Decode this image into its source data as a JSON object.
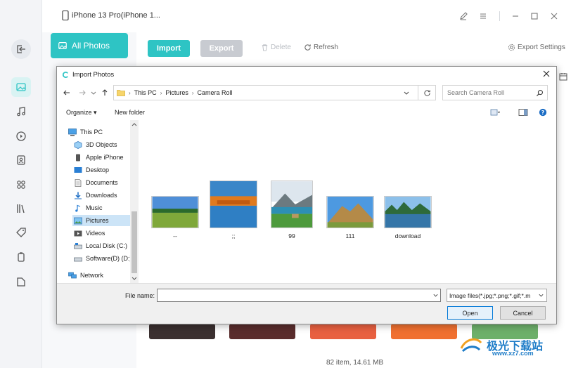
{
  "app": {
    "device_name": "iPhone 13 Pro(iPhone 1...",
    "nav_button": "All Photos",
    "toolbar": {
      "import_label": "Import",
      "export_label": "Export",
      "delete_label": "Delete",
      "refresh_label": "Refresh",
      "settings_label": "Export Settings"
    },
    "status": "82 item, 14.61 MB",
    "sidebar_icons": [
      "back-icon",
      "photos-icon",
      "music-icon",
      "video-icon",
      "contacts-icon",
      "apps-icon",
      "books-icon",
      "tag-icon",
      "battery-icon",
      "files-icon"
    ],
    "accent_color": "#2ec4c4"
  },
  "dialog": {
    "title": "Import Photos",
    "breadcrumb": [
      "This PC",
      "Pictures",
      "Camera Roll"
    ],
    "search_placeholder": "Search Camera Roll",
    "organize_label": "Organize ▾",
    "new_folder_label": "New folder",
    "tree": [
      {
        "label": "This PC"
      },
      {
        "label": "3D Objects"
      },
      {
        "label": "Apple iPhone"
      },
      {
        "label": "Desktop"
      },
      {
        "label": "Documents"
      },
      {
        "label": "Downloads"
      },
      {
        "label": "Music"
      },
      {
        "label": "Pictures"
      },
      {
        "label": "Videos"
      },
      {
        "label": "Local Disk (C:)"
      },
      {
        "label": "Software(D) (D:)"
      },
      {
        "label": "Network"
      }
    ],
    "files": [
      {
        "name": "--"
      },
      {
        "name": ";;"
      },
      {
        "name": "99"
      },
      {
        "name": "111"
      },
      {
        "name": "download"
      }
    ],
    "file_name_label": "File name:",
    "file_name_value": "",
    "file_type": "Image files(*.jpg;*.png;*.gif;*.m",
    "open_label": "Open",
    "cancel_label": "Cancel"
  },
  "watermark": {
    "text": "极光下载站",
    "sub": "www.xz7.com"
  }
}
